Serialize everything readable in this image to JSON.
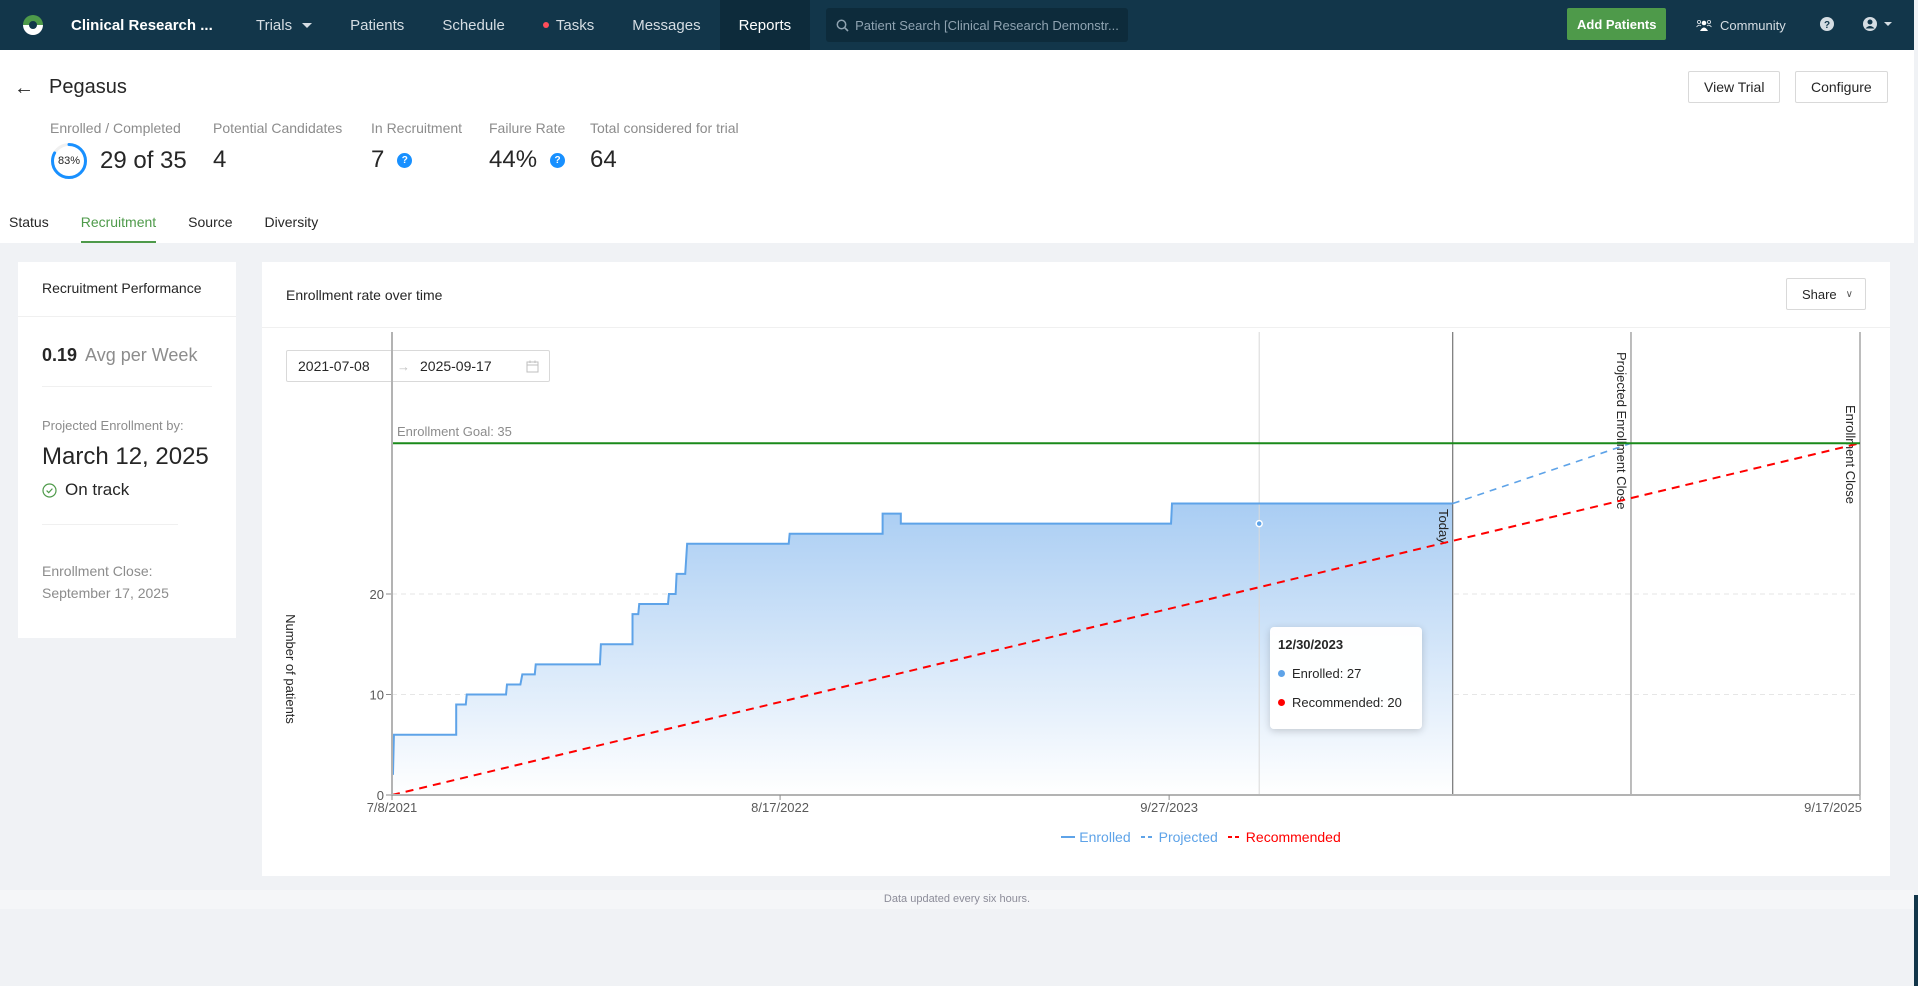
{
  "nav": {
    "brand": "Clinical Research ...",
    "items": [
      {
        "label": "Trials",
        "has_dropdown": true
      },
      {
        "label": "Patients"
      },
      {
        "label": "Schedule"
      },
      {
        "label": "Tasks",
        "has_badge_dot": true
      },
      {
        "label": "Messages"
      },
      {
        "label": "Reports",
        "active": true
      }
    ],
    "search_placeholder": "Patient Search [Clinical Research Demonstr...",
    "add_patients_label": "Add Patients",
    "community_label": "Community",
    "icons": {
      "logo": "app-logo",
      "search": "search-icon",
      "community": "community-icon",
      "help": "help-icon",
      "user": "user-icon"
    }
  },
  "header": {
    "title": "Pegasus",
    "view_trial_label": "View Trial",
    "configure_label": "Configure",
    "stats": [
      {
        "label": "Enrolled / Completed",
        "value": "29 of 35",
        "progress_percent": 83,
        "progress_label": "83%"
      },
      {
        "label": "Potential Candidates",
        "value": "4"
      },
      {
        "label": "In Recruitment",
        "value": "7",
        "help": true
      },
      {
        "label": "Failure Rate",
        "value": "44%",
        "help": true
      },
      {
        "label": "Total considered for trial",
        "value": "64"
      }
    ],
    "tabs": [
      {
        "label": "Status"
      },
      {
        "label": "Recruitment",
        "active": true
      },
      {
        "label": "Source"
      },
      {
        "label": "Diversity"
      }
    ]
  },
  "performance": {
    "title": "Recruitment Performance",
    "avg_value": "0.19",
    "avg_label": "Avg per Week",
    "projected_label": "Projected Enrollment by:",
    "projected_date": "March 12, 2025",
    "status_label": "On track",
    "close_label": "Enrollment Close:",
    "close_date": "September 17, 2025"
  },
  "chart_card": {
    "title": "Enrollment rate over time",
    "share_label": "Share",
    "range_start": "2021-07-08",
    "range_end": "2025-09-17"
  },
  "colors": {
    "brand_green": "#4e9a4a",
    "nav_bg": "#12364a",
    "enrolled": "#5ea3e8",
    "projected": "#5ea3e8",
    "recommended": "#ff0000",
    "goal": "#1a8a1a",
    "help": "#1890ff"
  },
  "chart_data": {
    "type": "line",
    "title": "Enrollment rate over time",
    "xlabel": "",
    "ylabel": "Number of patients",
    "x_start": "7/8/2021",
    "x_end": "9/17/2025",
    "x_total_days": 1532,
    "x_ticks": [
      {
        "label": "7/8/2021",
        "day": 0
      },
      {
        "label": "8/17/2022",
        "day": 405
      },
      {
        "label": "9/27/2023",
        "day": 811
      },
      {
        "label": "9/17/2025",
        "day": 1532
      }
    ],
    "y_ticks": [
      0,
      10,
      20
    ],
    "ylim": [
      0,
      37
    ],
    "grid": "horizontal-dashed",
    "goal": {
      "label": "Enrollment Goal: 35",
      "value": 35
    },
    "markers": [
      {
        "label": "Today",
        "day": 1107
      },
      {
        "label": "Projected Enrollment Close",
        "day": 1293
      },
      {
        "label": "Enrollment Close",
        "day": 1532
      }
    ],
    "series": [
      {
        "name": "Enrolled",
        "style": "step-area",
        "points": [
          [
            1,
            2
          ],
          [
            2,
            6
          ],
          [
            67,
            6
          ],
          [
            67,
            9
          ],
          [
            77,
            9
          ],
          [
            78,
            10
          ],
          [
            119,
            10
          ],
          [
            120,
            11
          ],
          [
            134,
            11
          ],
          [
            136,
            12
          ],
          [
            149,
            12
          ],
          [
            150,
            13
          ],
          [
            217,
            13
          ],
          [
            218,
            15
          ],
          [
            251,
            15
          ],
          [
            251,
            18
          ],
          [
            257,
            18
          ],
          [
            258,
            19
          ],
          [
            288,
            19
          ],
          [
            289,
            20
          ],
          [
            296,
            20
          ],
          [
            297,
            22
          ],
          [
            306,
            22
          ],
          [
            308,
            25
          ],
          [
            414,
            25
          ],
          [
            415,
            26
          ],
          [
            512,
            26
          ],
          [
            512,
            28
          ],
          [
            531,
            28
          ],
          [
            531,
            27
          ],
          [
            813,
            27
          ],
          [
            814,
            29
          ],
          [
            1107,
            29
          ]
        ]
      },
      {
        "name": "Projected",
        "style": "dashed",
        "points": [
          [
            1107,
            29
          ],
          [
            1293,
            35
          ]
        ]
      },
      {
        "name": "Recommended",
        "style": "dashed",
        "points": [
          [
            0,
            0
          ],
          [
            1532,
            35
          ]
        ]
      }
    ],
    "legend": [
      "Enrolled",
      "Projected",
      "Recommended"
    ],
    "legend_position": "bottom-center",
    "tooltip": {
      "date": "12/30/2023",
      "day": 905,
      "rows": [
        {
          "label": "Enrolled: 27",
          "series": "Enrolled"
        },
        {
          "label": "Recommended: 20",
          "series": "Recommended"
        }
      ]
    }
  },
  "footer": {
    "note": "Data updated every six hours."
  }
}
